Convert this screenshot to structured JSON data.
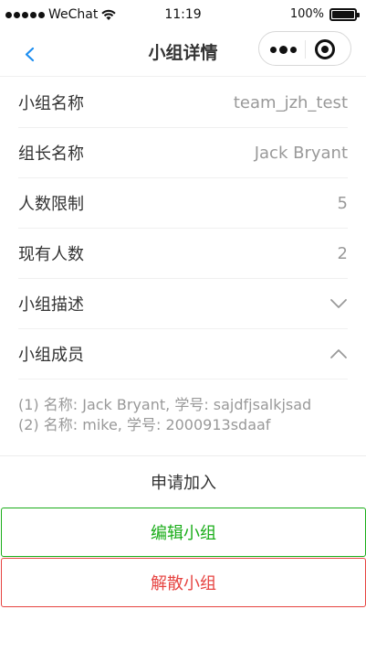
{
  "status_bar": {
    "carrier": "WeChat",
    "time": "11:19",
    "battery": "100%"
  },
  "nav": {
    "title": "小组详情"
  },
  "rows": [
    {
      "label": "小组名称",
      "value": "team_jzh_test"
    },
    {
      "label": "组长名称",
      "value": "Jack Bryant"
    },
    {
      "label": "人数限制",
      "value": "5"
    },
    {
      "label": "现有人数",
      "value": "2"
    },
    {
      "label": "小组描述",
      "value": ""
    },
    {
      "label": "小组成员",
      "value": ""
    }
  ],
  "members": [
    "(1) 名称: Jack Bryant, 学号: sajdfjsalkjsad",
    "(2) 名称: mike, 学号: 2000913sdaaf"
  ],
  "buttons": {
    "apply": "申请加入",
    "edit": "编辑小组",
    "disband": "解散小组"
  },
  "colors": {
    "back_arrow": "#1e8ef0",
    "edit": "#1aad19",
    "disband": "#e64340"
  }
}
